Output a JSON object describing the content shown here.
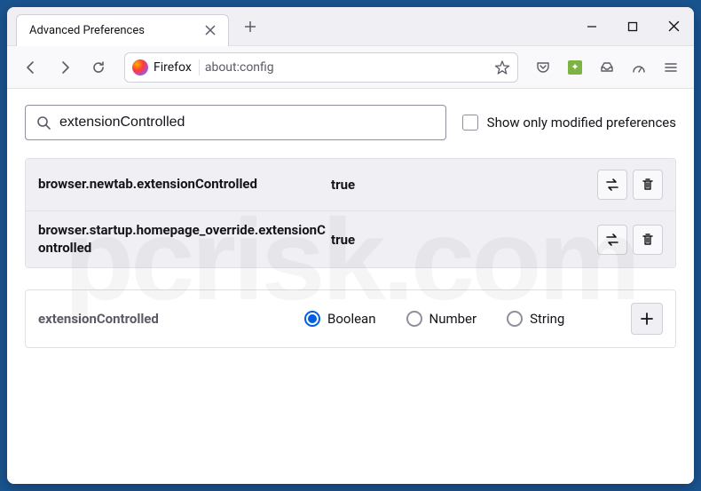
{
  "window": {
    "tab_title": "Advanced Preferences"
  },
  "urlbar": {
    "brand": "Firefox",
    "address": "about:config"
  },
  "search": {
    "value": "extensionControlled",
    "modified_only_label": "Show only modified preferences"
  },
  "prefs": [
    {
      "name": "browser.newtab.extensionControlled",
      "value": "true"
    },
    {
      "name": "browser.startup.homepage_override.extensionControlled",
      "value": "true"
    }
  ],
  "new_pref": {
    "name": "extensionControlled",
    "types": [
      "Boolean",
      "Number",
      "String"
    ],
    "selected": "Boolean"
  },
  "watermark": "pcrisk.com"
}
